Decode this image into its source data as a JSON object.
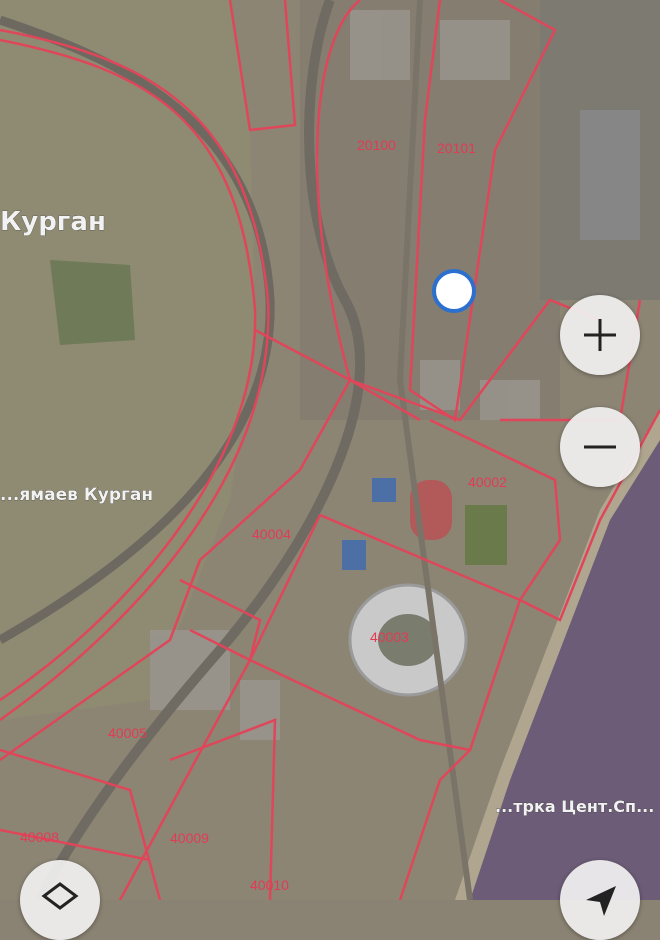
{
  "map": {
    "place_labels": [
      "Курган",
      "...ямаев Курган",
      "...трка Цент.Сп..."
    ],
    "zones": [
      "20100",
      "20101",
      "40002",
      "40003",
      "40004",
      "40005",
      "40008",
      "40009",
      "40010"
    ],
    "boundary_color": "#e0465a",
    "water_color": "#6e5d78"
  },
  "controls": {
    "zoom_in": "+",
    "zoom_out": "−",
    "layers_icon": "layers-icon",
    "locate_icon": "locate-arrow-icon"
  }
}
